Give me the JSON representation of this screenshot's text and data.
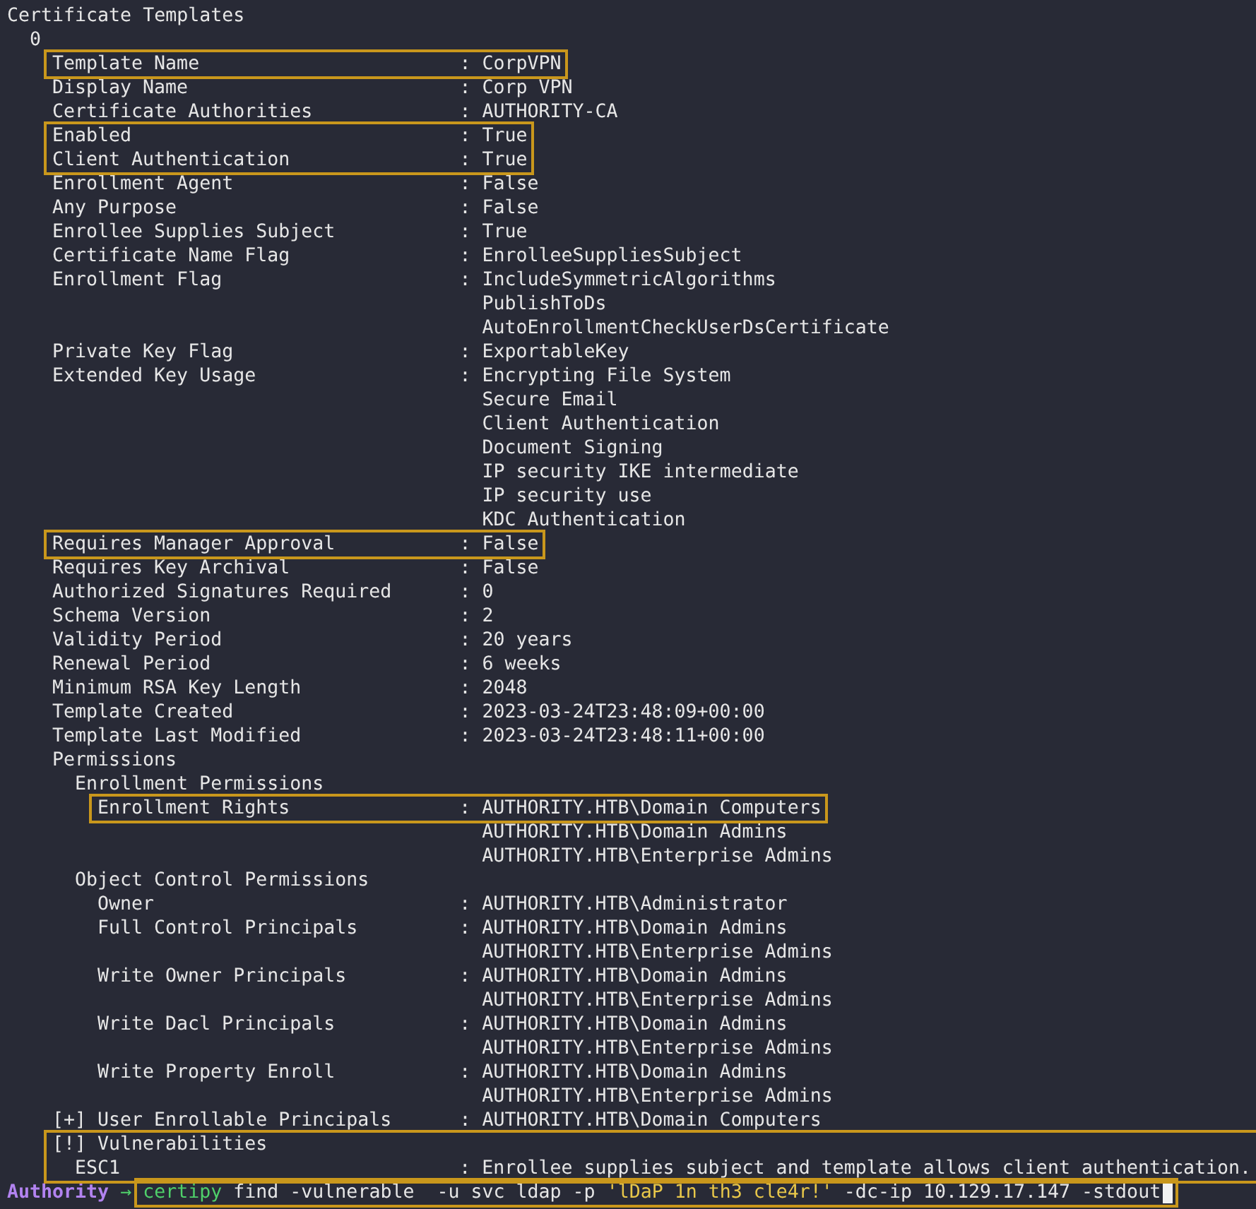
{
  "terminal": {
    "output": [
      {
        "key": "Certificate Templates",
        "highlighted": false,
        "children": [
          {
            "key": "0",
            "highlighted": false,
            "children": [
              {
                "key": "Template Name",
                "separator": ":",
                "values": [
                  "CorpVPN"
                ],
                "highlighted": true
              },
              {
                "key": "Display Name",
                "separator": ":",
                "values": [
                  "Corp VPN"
                ],
                "highlighted": false
              },
              {
                "key": "Certificate Authorities",
                "separator": ":",
                "values": [
                  "AUTHORITY-CA"
                ],
                "highlighted": false
              },
              {
                "key": "Enabled",
                "separator": ":",
                "values": [
                  "True"
                ],
                "highlighted": true
              },
              {
                "key": "Client Authentication",
                "separator": ":",
                "values": [
                  "True"
                ],
                "highlighted": true
              },
              {
                "key": "Enrollment Agent",
                "separator": ":",
                "values": [
                  "False"
                ],
                "highlighted": false
              },
              {
                "key": "Any Purpose",
                "separator": ":",
                "values": [
                  "False"
                ],
                "highlighted": false
              },
              {
                "key": "Enrollee Supplies Subject",
                "separator": ":",
                "values": [
                  "True"
                ],
                "highlighted": false
              },
              {
                "key": "Certificate Name Flag",
                "separator": ":",
                "values": [
                  "EnrolleeSuppliesSubject"
                ],
                "highlighted": false
              },
              {
                "key": "Enrollment Flag",
                "separator": ":",
                "values": [
                  "IncludeSymmetricAlgorithms",
                  "PublishToDs",
                  "AutoEnrollmentCheckUserDsCertificate"
                ],
                "highlighted": false
              },
              {
                "key": "Private Key Flag",
                "separator": ":",
                "values": [
                  "ExportableKey"
                ],
                "highlighted": false
              },
              {
                "key": "Extended Key Usage",
                "separator": ":",
                "values": [
                  "Encrypting File System",
                  "Secure Email",
                  "Client Authentication",
                  "Document Signing",
                  "IP security IKE intermediate",
                  "IP security use",
                  "KDC Authentication"
                ],
                "highlighted": false
              },
              {
                "key": "Requires Manager Approval",
                "separator": ":",
                "values": [
                  "False"
                ],
                "highlighted": true
              },
              {
                "key": "Requires Key Archival",
                "separator": ":",
                "values": [
                  "False"
                ],
                "highlighted": false
              },
              {
                "key": "Authorized Signatures Required",
                "separator": ":",
                "values": [
                  "0"
                ],
                "highlighted": false
              },
              {
                "key": "Schema Version",
                "separator": ":",
                "values": [
                  "2"
                ],
                "highlighted": false
              },
              {
                "key": "Validity Period",
                "separator": ":",
                "values": [
                  "20 years"
                ],
                "highlighted": false
              },
              {
                "key": "Renewal Period",
                "separator": ":",
                "values": [
                  "6 weeks"
                ],
                "highlighted": false
              },
              {
                "key": "Minimum RSA Key Length",
                "separator": ":",
                "values": [
                  "2048"
                ],
                "highlighted": false
              },
              {
                "key": "Template Created",
                "separator": ":",
                "values": [
                  "2023-03-24T23:48:09+00:00"
                ],
                "highlighted": false
              },
              {
                "key": "Template Last Modified",
                "separator": ":",
                "values": [
                  "2023-03-24T23:48:11+00:00"
                ],
                "highlighted": false
              },
              {
                "key": "Permissions",
                "highlighted": false,
                "children": [
                  {
                    "key": "Enrollment Permissions",
                    "highlighted": false,
                    "children": [
                      {
                        "key": "Enrollment Rights",
                        "separator": ":",
                        "values": [
                          "AUTHORITY.HTB\\Domain Computers",
                          "AUTHORITY.HTB\\Domain Admins",
                          "AUTHORITY.HTB\\Enterprise Admins"
                        ],
                        "highlighted": true
                      }
                    ]
                  },
                  {
                    "key": "Object Control Permissions",
                    "highlighted": false,
                    "children": [
                      {
                        "key": "Owner",
                        "separator": ":",
                        "values": [
                          "AUTHORITY.HTB\\Administrator"
                        ],
                        "highlighted": false
                      },
                      {
                        "key": "Full Control Principals",
                        "separator": ":",
                        "values": [
                          "AUTHORITY.HTB\\Domain Admins",
                          "AUTHORITY.HTB\\Enterprise Admins"
                        ],
                        "highlighted": false
                      },
                      {
                        "key": "Write Owner Principals",
                        "separator": ":",
                        "values": [
                          "AUTHORITY.HTB\\Domain Admins",
                          "AUTHORITY.HTB\\Enterprise Admins"
                        ],
                        "highlighted": false
                      },
                      {
                        "key": "Write Dacl Principals",
                        "separator": ":",
                        "values": [
                          "AUTHORITY.HTB\\Domain Admins",
                          "AUTHORITY.HTB\\Enterprise Admins"
                        ],
                        "highlighted": false
                      },
                      {
                        "key": "Write Property Enroll",
                        "separator": ":",
                        "values": [
                          "AUTHORITY.HTB\\Domain Admins",
                          "AUTHORITY.HTB\\Enterprise Admins"
                        ],
                        "highlighted": false
                      }
                    ]
                  }
                ]
              },
              {
                "key": "[+] User Enrollable Principals",
                "separator": ":",
                "values": [
                  "AUTHORITY.HTB\\Domain Computers"
                ],
                "highlighted": false
              },
              {
                "key": "[!] Vulnerabilities",
                "highlighted": true,
                "children": [
                  {
                    "key": "ESC1",
                    "separator": ":",
                    "values": [
                      "Enrollee supplies subject and template allows client authentication."
                    ],
                    "highlighted": false
                  }
                ]
              }
            ]
          }
        ]
      }
    ],
    "prompt": {
      "host": "Authority",
      "arrow": "→",
      "highlighted": true,
      "command": [
        {
          "kind": "program",
          "text": "certipy"
        },
        {
          "kind": "arg",
          "text": " find -vulnerable  -u svc ldap -p "
        },
        {
          "kind": "string",
          "text": "'lDaP 1n th3 cle4r!'"
        },
        {
          "kind": "arg",
          "text": " -dc-ip 10.129.17.147 -stdout"
        }
      ]
    }
  }
}
